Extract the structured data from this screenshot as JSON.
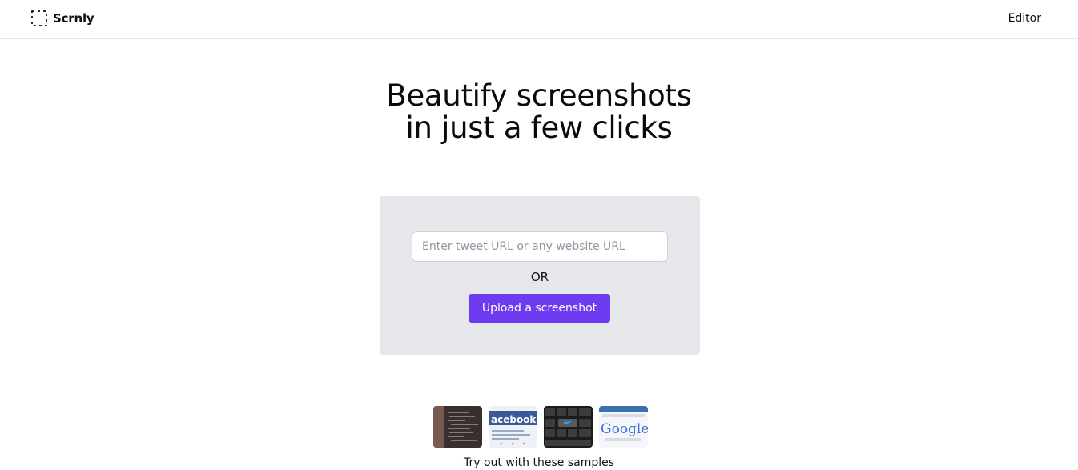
{
  "nav": {
    "brand": "Scrnly",
    "editor_link": "Editor"
  },
  "hero": {
    "title_line1": "Beautify screenshots",
    "title_line2": "in just a few clicks"
  },
  "card": {
    "url_placeholder": "Enter tweet URL or any website URL",
    "url_value": "",
    "or_label": "OR",
    "upload_label": "Upload a screenshot"
  },
  "samples": {
    "items": [
      {
        "icon": "code-photo-thumbnail"
      },
      {
        "icon": "facebook-thumbnail",
        "text": "acebook"
      },
      {
        "icon": "twitter-keyboard-thumbnail"
      },
      {
        "icon": "google-thumbnail",
        "text": "Google"
      }
    ],
    "caption": "Try out with these samples"
  },
  "colors": {
    "accent": "#6d3cf0",
    "card_bg": "#e5e7eb"
  }
}
